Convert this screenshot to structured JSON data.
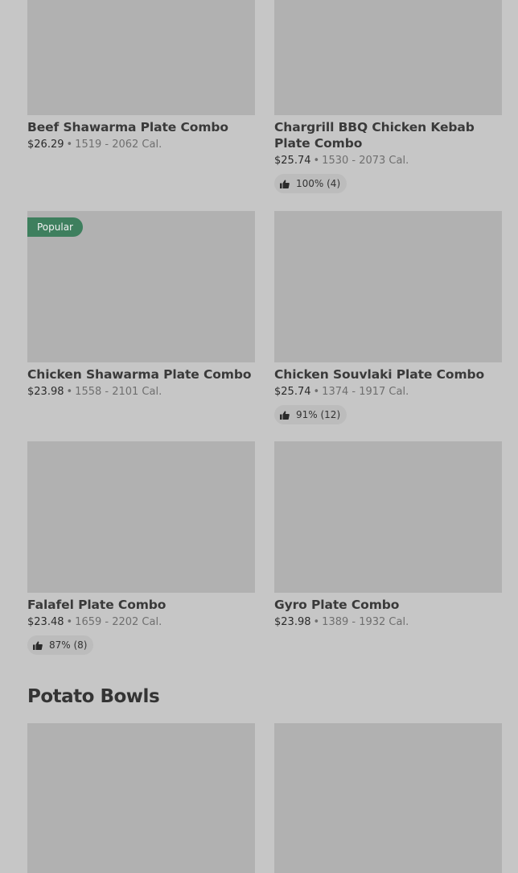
{
  "items": [
    {
      "name": "Beef Shawarma Plate Combo",
      "price": "$26.29",
      "calories": "1519 - 2062 Cal."
    },
    {
      "name": "Chargrill BBQ Chicken Kebab Plate Combo",
      "price": "$25.74",
      "calories": "1530 - 2073 Cal.",
      "rating": "100% (4)",
      "rating_icon": "thumbs-up-icon"
    },
    {
      "name": "Chicken Shawarma Plate Combo",
      "price": "$23.98",
      "calories": "1558 - 2101 Cal.",
      "badge": "Popular",
      "badge_color": "#3e7f5e"
    },
    {
      "name": "Chicken Souvlaki Plate Combo",
      "price": "$25.74",
      "calories": "1374 - 1917 Cal.",
      "rating": "91% (12)",
      "rating_icon": "thumbs-up-icon"
    },
    {
      "name": "Falafel Plate Combo",
      "price": "$23.48",
      "calories": "1659 - 2202 Cal.",
      "rating": "87% (8)",
      "rating_icon": "thumbs-up-icon"
    },
    {
      "name": "Gyro Plate Combo",
      "price": "$23.98",
      "calories": "1389 - 1932 Cal."
    }
  ],
  "sections": {
    "potato_bowls_title": "Potato Bowls"
  },
  "separator": "•"
}
